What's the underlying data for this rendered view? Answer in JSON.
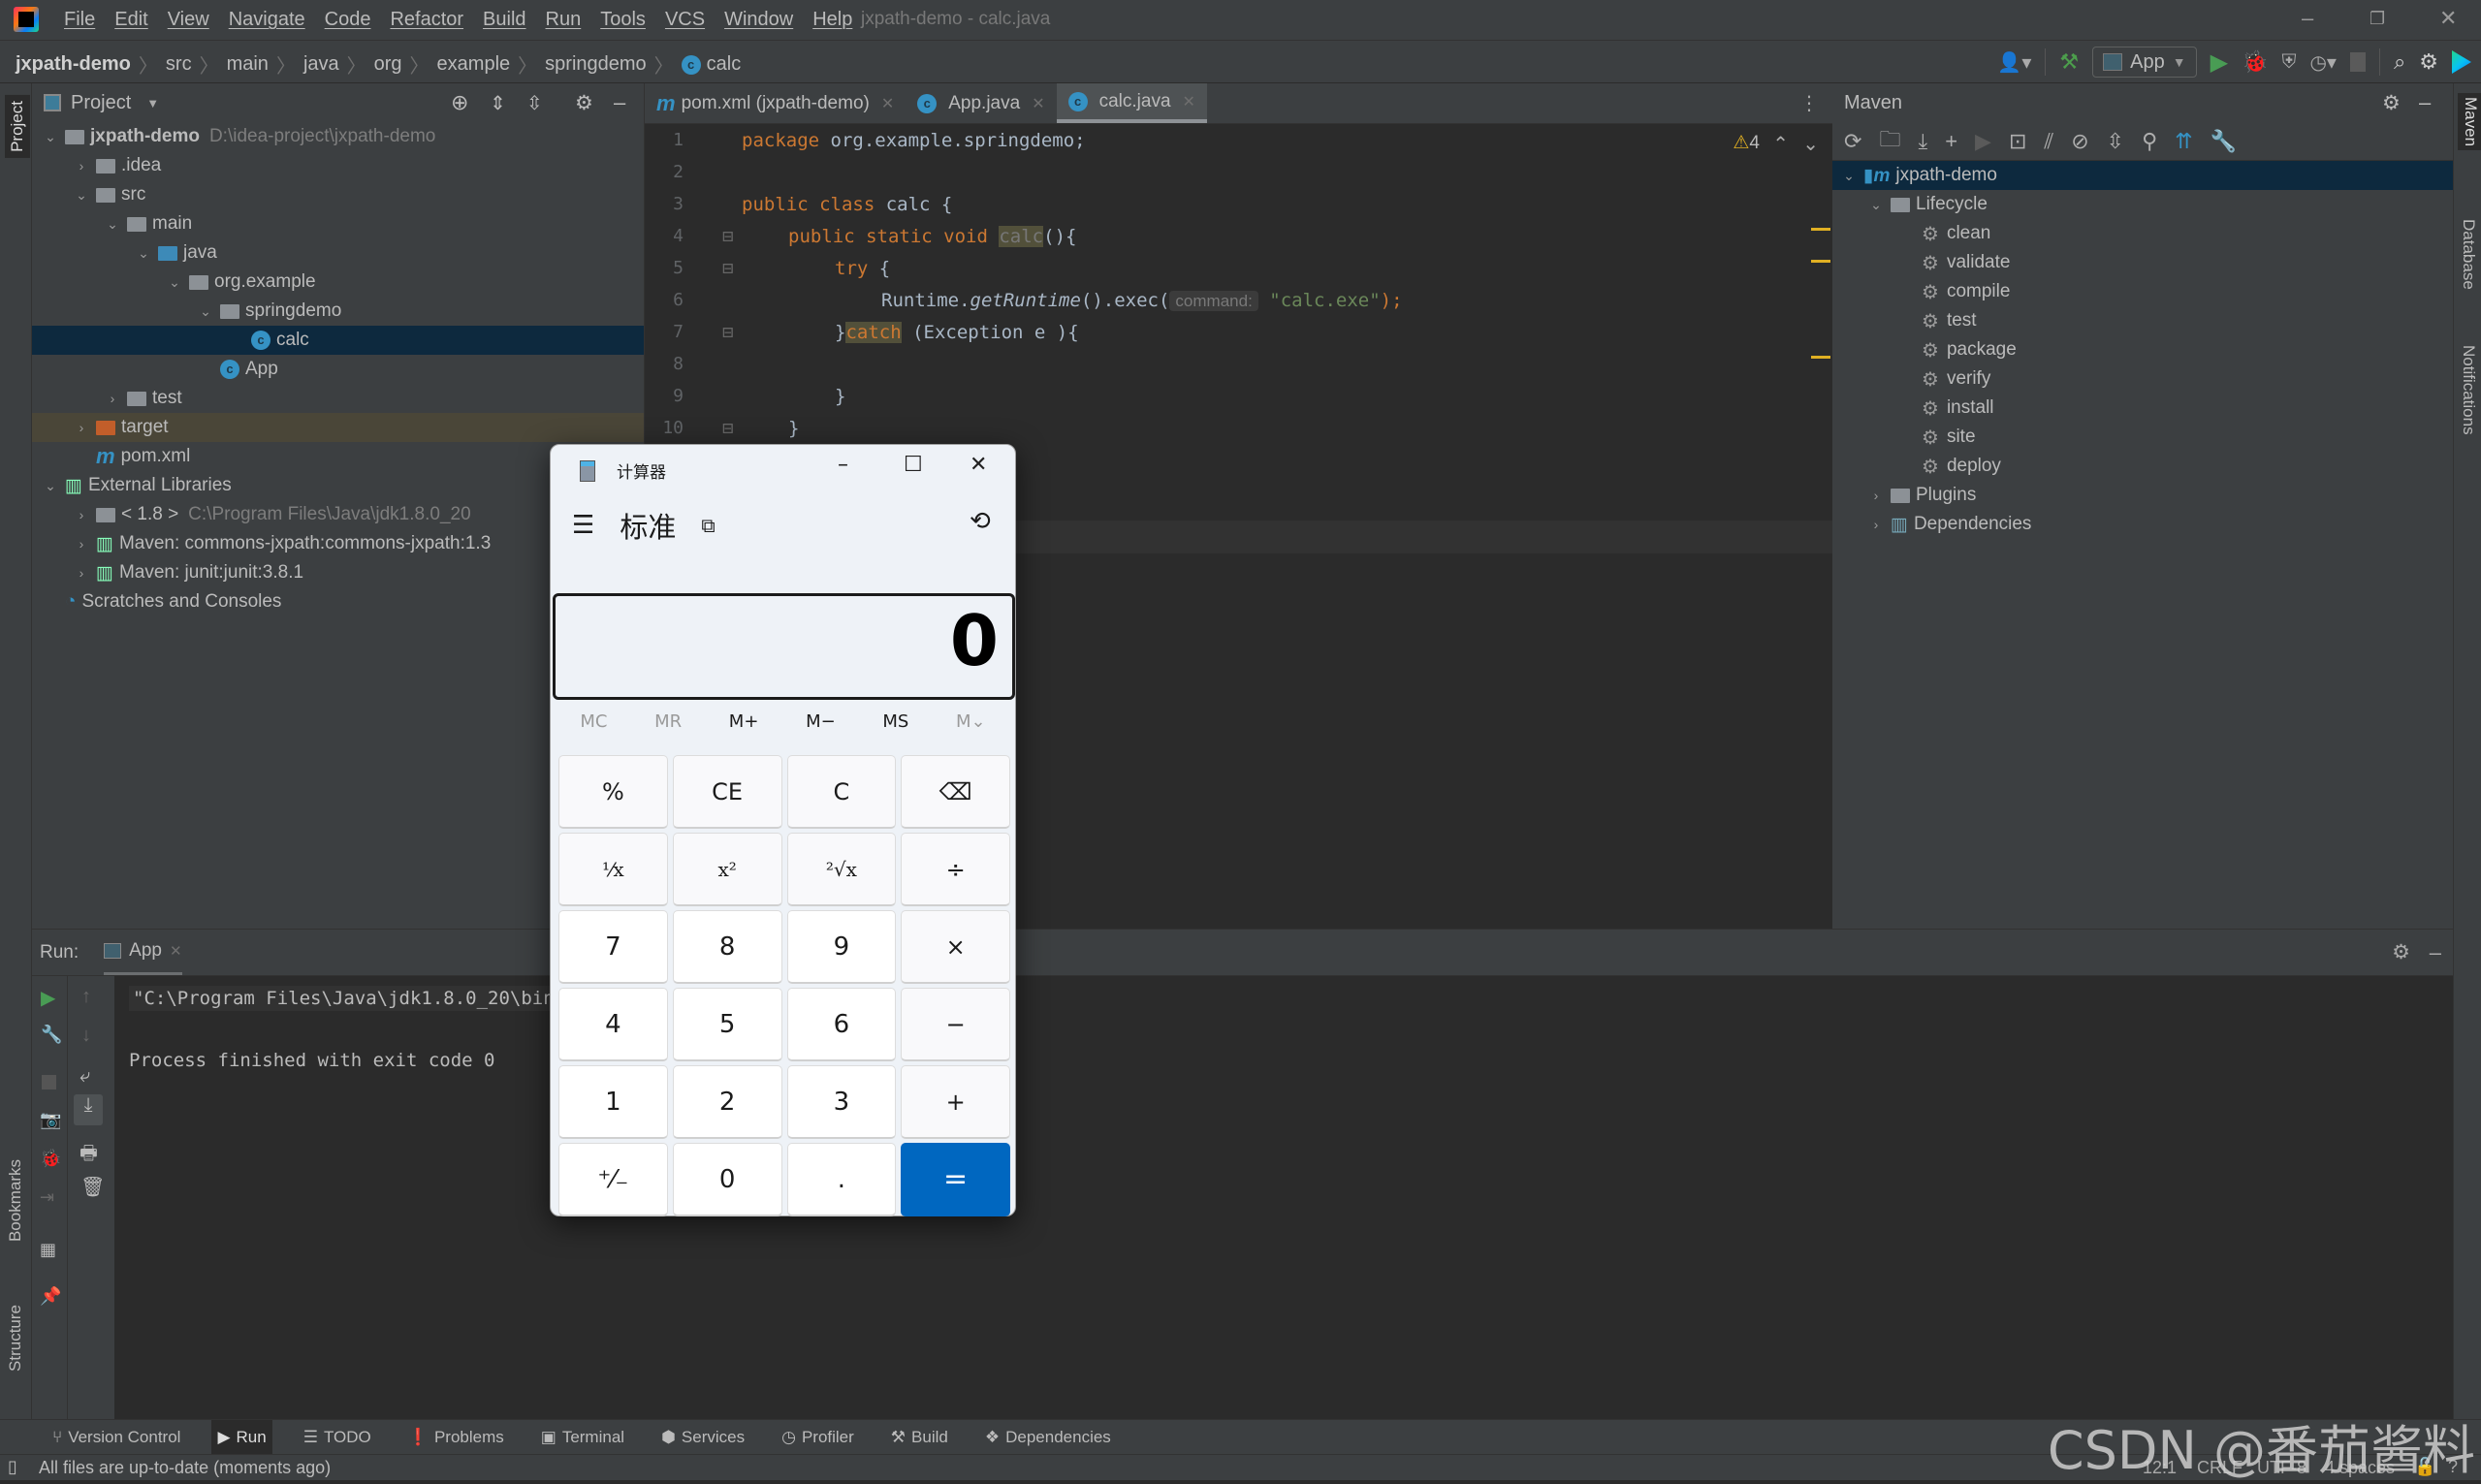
{
  "window": {
    "title": "jxpath-demo - calc.java"
  },
  "menu": [
    "File",
    "Edit",
    "View",
    "Navigate",
    "Code",
    "Refactor",
    "Build",
    "Run",
    "Tools",
    "VCS",
    "Window",
    "Help"
  ],
  "breadcrumb": {
    "items": [
      "jxpath-demo",
      "src",
      "main",
      "java",
      "org",
      "example",
      "springdemo"
    ],
    "current": "calc"
  },
  "toolbar": {
    "run_config": "App"
  },
  "left_strip": {
    "project": "Project",
    "bookmarks": "Bookmarks",
    "structure": "Structure"
  },
  "right_strip": {
    "maven": "Maven",
    "database": "Database",
    "notifications": "Notifications"
  },
  "project": {
    "title": "Project",
    "tree": [
      {
        "label": "jxpath-demo",
        "extra": "D:\\idea-project\\jxpath-demo",
        "depth": 0,
        "expanded": true,
        "icon": "module"
      },
      {
        "label": ".idea",
        "depth": 1,
        "expanded": false,
        "icon": "folder"
      },
      {
        "label": "src",
        "depth": 1,
        "expanded": true,
        "icon": "folder"
      },
      {
        "label": "main",
        "depth": 2,
        "expanded": true,
        "icon": "folder"
      },
      {
        "label": "java",
        "depth": 3,
        "expanded": true,
        "icon": "source-folder"
      },
      {
        "label": "org.example",
        "depth": 4,
        "expanded": true,
        "icon": "package"
      },
      {
        "label": "springdemo",
        "depth": 5,
        "expanded": true,
        "icon": "package"
      },
      {
        "label": "calc",
        "depth": 6,
        "icon": "class",
        "selected": true
      },
      {
        "label": "App",
        "depth": 5,
        "icon": "class-runnable"
      },
      {
        "label": "test",
        "depth": 2,
        "expanded": false,
        "icon": "folder"
      },
      {
        "label": "target",
        "depth": 1,
        "expanded": false,
        "icon": "excluded-folder"
      },
      {
        "label": "pom.xml",
        "depth": 1,
        "icon": "maven"
      },
      {
        "label": "External Libraries",
        "depth": 0,
        "expanded": true,
        "icon": "libraries"
      },
      {
        "label": "< 1.8 >",
        "extra": "C:\\Program Files\\Java\\jdk1.8.0_20",
        "depth": 1,
        "expanded": false,
        "icon": "jdk"
      },
      {
        "label": "Maven: commons-jxpath:commons-jxpath:1.3",
        "depth": 1,
        "expanded": false,
        "icon": "library"
      },
      {
        "label": "Maven: junit:junit:3.8.1",
        "depth": 1,
        "expanded": false,
        "icon": "library"
      },
      {
        "label": "Scratches and Consoles",
        "depth": 0,
        "icon": "scratches"
      }
    ]
  },
  "editor": {
    "tabs": [
      {
        "label": "pom.xml (jxpath-demo)",
        "icon": "maven",
        "active": false
      },
      {
        "label": "App.java",
        "icon": "class-runnable",
        "active": false
      },
      {
        "label": "calc.java",
        "icon": "class",
        "active": true
      }
    ],
    "warnings": "4",
    "line_numbers": [
      "1",
      "2",
      "3",
      "4",
      "5",
      "6",
      "7",
      "8",
      "9",
      "10"
    ],
    "code": {
      "l1_kw": "package",
      "l1_rest": " org.example.springdemo;",
      "l3_kw": "public class",
      "l3_rest": " calc {",
      "l4_kw": "public static void",
      "l4_name": "calc",
      "l4_rest": "(){",
      "l5_kw": "try",
      "l5_rest": " {",
      "l6_a": "Runtime.",
      "l6_b": "getRuntime",
      "l6_c": "().exec(",
      "l6_hint": "command:",
      "l6_str": "\"calc.exe\"",
      "l6_d": ");",
      "l7_a": "}",
      "l7_kw": "catch",
      "l7_rest": " (Exception e ){",
      "l9": "}",
      "l10": "}"
    }
  },
  "maven": {
    "title": "Maven",
    "root": "jxpath-demo",
    "lifecycle_label": "Lifecycle",
    "lifecycle": [
      "clean",
      "validate",
      "compile",
      "test",
      "package",
      "verify",
      "install",
      "site",
      "deploy"
    ],
    "plugins": "Plugins",
    "dependencies": "Dependencies"
  },
  "run": {
    "label": "Run:",
    "tab": "App",
    "console": [
      "\"C:\\Program Files\\Java\\jdk1.8.0_20\\bin\\java.exe\" ...",
      "",
      "Process finished with exit code 0"
    ]
  },
  "bottom_tabs": [
    "Version Control",
    "Run",
    "TODO",
    "Problems",
    "Terminal",
    "Services",
    "Profiler",
    "Build",
    "Dependencies"
  ],
  "status": {
    "message": "All files are up-to-date (moments ago)",
    "position": "12:1",
    "line_sep": "CRLF",
    "encoding": "UTF-8",
    "indent": "4 spaces"
  },
  "calculator": {
    "title": "计算器",
    "mode": "标准",
    "display": "0",
    "memory": [
      {
        "label": "MC",
        "enabled": false
      },
      {
        "label": "MR",
        "enabled": false
      },
      {
        "label": "M+",
        "enabled": true
      },
      {
        "label": "M−",
        "enabled": true
      },
      {
        "label": "MS",
        "enabled": true
      },
      {
        "label": "M⌄",
        "enabled": false
      }
    ],
    "keys": [
      "%",
      "CE",
      "C",
      "⌫",
      "¹⁄x",
      "x²",
      "²√x",
      "÷",
      "7",
      "8",
      "9",
      "×",
      "4",
      "5",
      "6",
      "−",
      "1",
      "2",
      "3",
      "+",
      "⁺⁄₋",
      "0",
      ".",
      "="
    ]
  },
  "watermark": "CSDN @番茄酱料",
  "colors": {
    "accent": "#0067c0",
    "selection": "#0d293e",
    "keyword": "#cc7832",
    "string": "#6a8759",
    "warning": "#e0b023"
  }
}
